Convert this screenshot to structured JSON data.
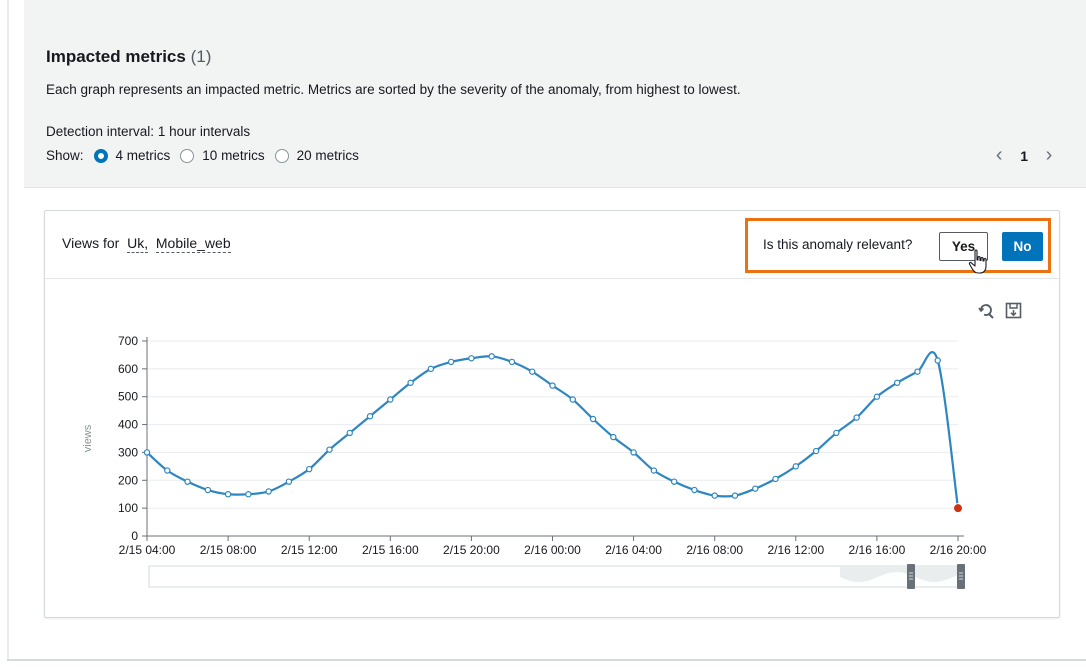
{
  "header": {
    "title": "Impacted metrics",
    "count": "(1)",
    "description": "Each graph represents an impacted metric. Metrics are sorted by the severity of the anomaly, from highest to lowest.",
    "interval_label": "Detection interval:",
    "interval_value": "1 hour intervals",
    "show_label": "Show:",
    "options": [
      "4 metrics",
      "10 metrics",
      "20 metrics"
    ],
    "selected_option": "4 metrics",
    "page": "1"
  },
  "card": {
    "views_for": "Views for",
    "dimension_1": "Uk,",
    "dimension_2": "Mobile_web",
    "relevant_question": "Is this anomaly relevant?",
    "yes_label": "Yes",
    "no_label": "No",
    "accent": "#ec7211",
    "primary": "#0073bb"
  },
  "icons": [
    "refresh-zoom-icon",
    "download-icon",
    "pointer-hand-icon"
  ],
  "chart_data": {
    "type": "line",
    "ylabel": "views",
    "ylim": [
      0,
      700
    ],
    "yticks": [
      "0",
      "100",
      "200",
      "300",
      "400",
      "500",
      "600",
      "700"
    ],
    "xticks": [
      "2/15 04:00",
      "2/15 08:00",
      "2/15 12:00",
      "2/15 16:00",
      "2/15 20:00",
      "2/16 00:00",
      "2/16 04:00",
      "2/16 08:00",
      "2/16 12:00",
      "2/16 16:00",
      "2/16 20:00"
    ],
    "grid": true,
    "series": [
      {
        "values": [
          300,
          235,
          195,
          165,
          150,
          150,
          160,
          195,
          240,
          310,
          370,
          430,
          490,
          550,
          600,
          625,
          638,
          645,
          625,
          590,
          540,
          490,
          420,
          355,
          300,
          235,
          195,
          165,
          145,
          145,
          170,
          205,
          250,
          305,
          370,
          425,
          500,
          550,
          590,
          630,
          100
        ],
        "color": "#2e86c1"
      }
    ],
    "anomaly_point": {
      "index": 40,
      "value": 100,
      "color": "#d13212"
    }
  }
}
